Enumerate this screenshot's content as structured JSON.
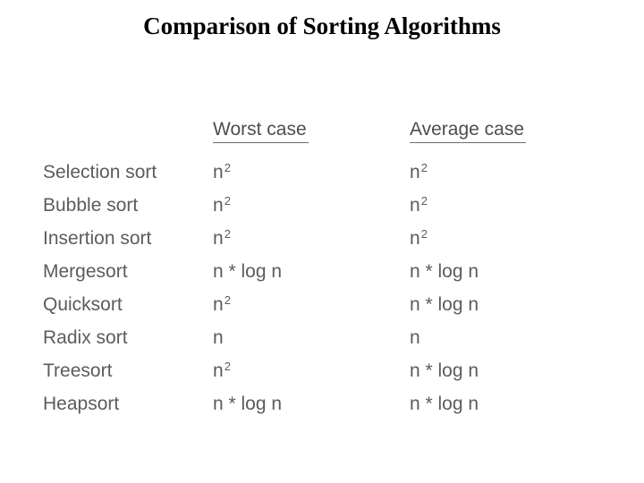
{
  "title": "Comparison of Sorting Algorithms",
  "headers": {
    "worst": "Worst case",
    "average": "Average case"
  },
  "rows": [
    {
      "name": "Selection sort",
      "worst": {
        "base": "n",
        "sup": "2"
      },
      "avg": {
        "base": "n",
        "sup": "2"
      }
    },
    {
      "name": "Bubble sort",
      "worst": {
        "base": "n",
        "sup": "2"
      },
      "avg": {
        "base": "n",
        "sup": "2"
      }
    },
    {
      "name": "Insertion sort",
      "worst": {
        "base": "n",
        "sup": "2"
      },
      "avg": {
        "base": "n",
        "sup": "2"
      }
    },
    {
      "name": "Mergesort",
      "worst": {
        "text": "n * log n"
      },
      "avg": {
        "text": "n * log n"
      }
    },
    {
      "name": "Quicksort",
      "worst": {
        "base": "n",
        "sup": "2"
      },
      "avg": {
        "text": "n * log n"
      }
    },
    {
      "name": "Radix sort",
      "worst": {
        "text": "n"
      },
      "avg": {
        "text": "n"
      }
    },
    {
      "name": "Treesort",
      "worst": {
        "base": "n",
        "sup": "2"
      },
      "avg": {
        "text": "n * log n"
      }
    },
    {
      "name": "Heapsort",
      "worst": {
        "text": "n * log n"
      },
      "avg": {
        "text": "n * log n"
      }
    }
  ]
}
